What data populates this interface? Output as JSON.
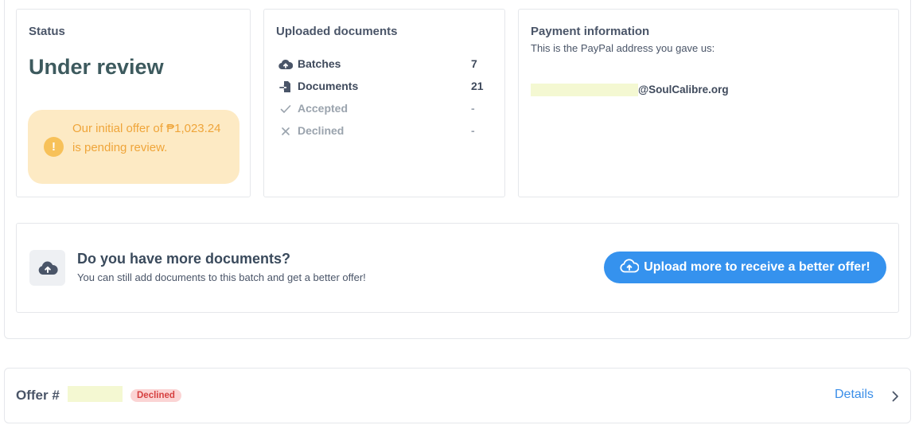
{
  "status_card": {
    "title": "Status",
    "status": "Under review",
    "pending_message": "Our initial offer of ₱1,023.24 is pending review."
  },
  "docs_card": {
    "title": "Uploaded documents",
    "rows": [
      {
        "icon": "cloud-upload-icon",
        "label": "Batches",
        "value": "7"
      },
      {
        "icon": "file-import-icon",
        "label": "Documents",
        "value": "21"
      },
      {
        "icon": "check-icon",
        "label": "Accepted",
        "value": "-"
      },
      {
        "icon": "x-icon",
        "label": "Declined",
        "value": "-"
      }
    ]
  },
  "payment_card": {
    "title": "Payment information",
    "subtitle": "This is the PayPal address you gave us:",
    "email_domain": "@SoulCalibre.org"
  },
  "more_docs": {
    "title": "Do you have more documents?",
    "subtitle": "You can still add documents to this batch and get a better offer!",
    "button_label": "Upload more to receive a better offer!"
  },
  "offer": {
    "label": "Offer #",
    "badge": "Declined",
    "details_label": "Details"
  },
  "colors": {
    "accent_blue": "#3592ee",
    "pending_bg": "#fdeac4",
    "pending_text": "#efa53a",
    "declined_bg": "#fbd4d4",
    "declined_text": "#d64040"
  }
}
